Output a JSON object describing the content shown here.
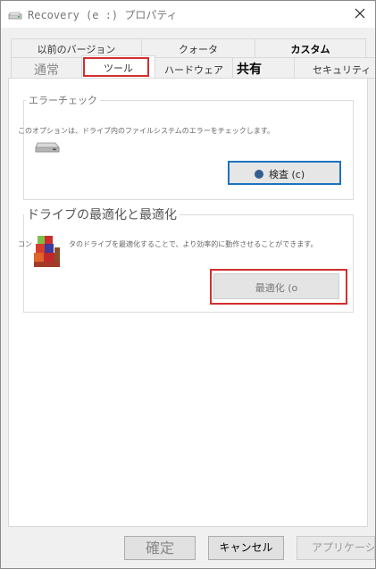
{
  "window": {
    "title": "Recovery (e :) プロパティ"
  },
  "tabs_row1": [
    {
      "label": "以前のバージョン"
    },
    {
      "label": "クォータ"
    },
    {
      "label": "カスタム"
    }
  ],
  "tabs_row2": [
    {
      "label": "通常"
    },
    {
      "label": "ツール",
      "selected": true
    },
    {
      "label": "ハードウェア"
    },
    {
      "label": "共有"
    },
    {
      "label": "セキュリティ"
    }
  ],
  "error_check": {
    "title": "エラーチェック",
    "description": "このオプションは、ドライブ内のファイルシステムのエラーをチェックします。",
    "button_label": "検査 (c)",
    "icon": "drive-icon"
  },
  "optimize": {
    "title": "ドライブの最適化と最適化",
    "description_prefix": "コン",
    "description": "タのドライブを最適化することで、より効率的に動作させることができます。",
    "button_label": "最適化 (o",
    "icon": "defrag-icon"
  },
  "footer": {
    "ok_label": "確定",
    "cancel_label": "キャンセル",
    "apply_label": "アプリケーション"
  },
  "colors": {
    "highlight_red": "#d32f2f",
    "focus_blue": "#1e73be"
  }
}
